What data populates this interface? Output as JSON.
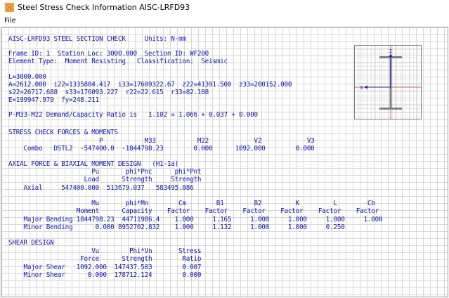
{
  "window": {
    "title": "Steel Stress Check Information  AISC-LRFD93",
    "icon": "etabs-app-icon"
  },
  "menu": {
    "items": [
      "File"
    ]
  },
  "report": {
    "header_line": "AISC-LRFD93 STEEL SECTION CHECK     Units: N-mm",
    "frame_line": "Frame ID: 1  Station Loc: 3000.000  Section ID: WF200",
    "element_line": "Element Type:  Moment Resisting   Classification:  Seismic",
    "length_line": "L=3000.000",
    "props_line1": "A=2612.000  i22=1335884.417  i33=17609322.67  z22=41391.500  z33=200152.000",
    "props_line2": "s22=26717.688  s33=176093.227  r22=22.615  r33=82.108",
    "props_line3": "E=199947.979  fy=248.211",
    "ratio_line": "P-M33-M22 Demand/Capacity Ratio is   1.102 = 1.066 + 0.037 + 0.000",
    "stress_header": "STRESS CHECK FORCES & MOMENTS",
    "stress_cols": "                        P           M33           M22            V2            V3",
    "stress_row": "    Combo   DSTL2  -547400.0  -1844798.23        0.000      1092.000        0.000",
    "axial_header": "AXIAL FORCE & BIAXIAL MOMENT DESIGN   (H1-1a)",
    "axial_cols1": "                      Pu       phi*Pnc      phi*Pnt",
    "axial_cols2": "                    Load      Strength     Strength",
    "axial_row": "    Axial     547400.000  513679.037   583495.086",
    "bend_cols1": "                      Mu       phi*Mn        Cm        B1        B2         K         L        Cb",
    "bend_cols2": "                  Moment      Capacity    Factor    Factor    Factor    Factor    Factor    Factor",
    "major_bend_row": "    Major Bending 1844798.23  44711986.4    1.000     1.165     1.000     1.000     1.000     1.000",
    "minor_bend_row": "    Minor Bending      0.000 8952702.832    1.000     1.132     1.000     1.000     0.250",
    "shear_header": "SHEAR DESIGN",
    "shear_cols1": "                      Vu        Phi*Vn       Stress",
    "shear_cols2": "                   Force      Strength        Ratio",
    "major_shear_row": "    Major Shear   1092.000  147437.503        0.007",
    "minor_shear_row": "    Minor Shear      0.000  178712.124        0.000"
  },
  "section_view": {
    "axis2_label": "2",
    "axis3_label": "3",
    "section_color": "#808080",
    "axis_color": "#2020c0",
    "centerline_color": "#e03030"
  },
  "colors": {
    "report_text": "#1515b8",
    "grid": "#d8d8d8"
  }
}
